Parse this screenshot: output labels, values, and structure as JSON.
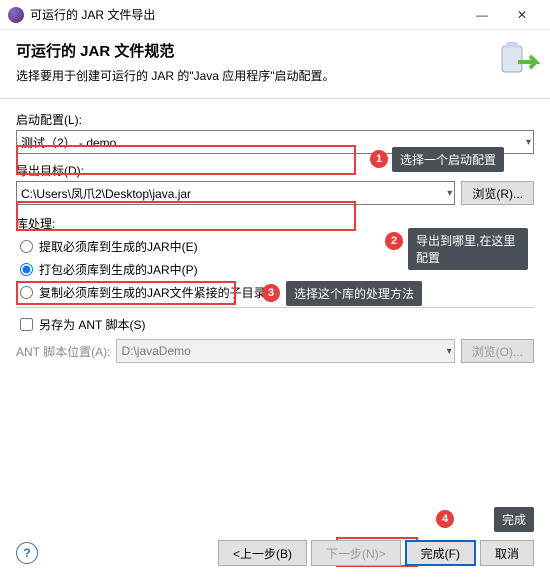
{
  "title_bar": {
    "title": "可运行的 JAR 文件导出",
    "min": "—",
    "close": "✕"
  },
  "header": {
    "heading": "可运行的 JAR 文件规范",
    "subheading": "选择要用于创建可运行的 JAR 的\"Java 应用程序\"启动配置。"
  },
  "launch": {
    "label": "启动配置(L):",
    "value": "测试（2） - demo"
  },
  "dest": {
    "label": "导出目标(D):",
    "value": "C:\\Users\\凤爪2\\Desktop\\java.jar",
    "browse": "浏览(R)..."
  },
  "lib": {
    "label": "库处理:",
    "opt1": "提取必须库到生成的JAR中(E)",
    "opt2": "打包必须库到生成的JAR中(P)",
    "opt3": "复制必须库到生成的JAR文件紧接的子目录中"
  },
  "ant": {
    "check": "另存为 ANT 脚本(S)",
    "loc_label": "ANT 脚本位置(A):",
    "loc_value": "D:\\javaDemo",
    "browse": "浏览(O)..."
  },
  "annot": {
    "n1": "1",
    "t1": "选择一个启动配置",
    "n2": "2",
    "t2": "导出到哪里,在这里配置",
    "n3": "3",
    "t3": "选择这个库的处理方法",
    "n4": "4",
    "t4": "完成"
  },
  "footer": {
    "help": "?",
    "back": "<上一步(B)",
    "next": "下一步(N)>",
    "finish": "完成(F)",
    "cancel": "取消"
  }
}
